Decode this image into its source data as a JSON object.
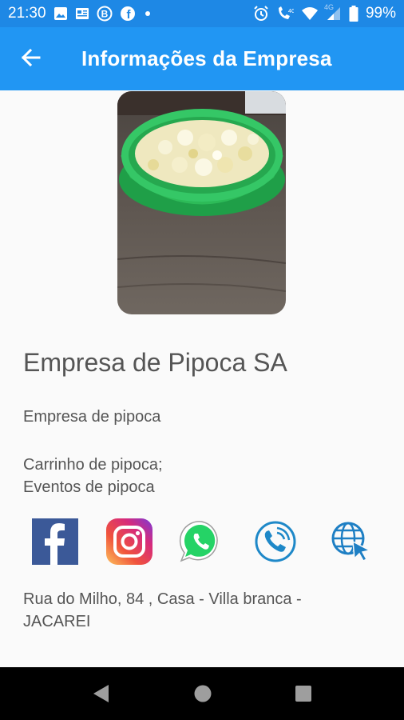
{
  "status_bar": {
    "time": "21:30",
    "network": "4G",
    "battery": "99%"
  },
  "app_bar": {
    "title": "Informações da Empresa"
  },
  "company": {
    "name": "Empresa de Pipoca SA",
    "description": "Empresa de pipoca",
    "services": [
      "Carrinho de pipoca;",
      "Eventos de pipoca"
    ],
    "address_line1": "Rua do Milho, 84 , Casa - Villa branca -",
    "address_line2": "JACAREI"
  },
  "social_links": [
    "facebook-icon",
    "instagram-icon",
    "whatsapp-icon",
    "phone-icon",
    "website-icon"
  ],
  "colors": {
    "status_bar": "#1e88e5",
    "app_bar": "#2196f3",
    "text": "#555555",
    "facebook": "#3b5998",
    "whatsapp": "#25d366",
    "phone": "#1e88c8",
    "web": "#1e7fc4"
  }
}
